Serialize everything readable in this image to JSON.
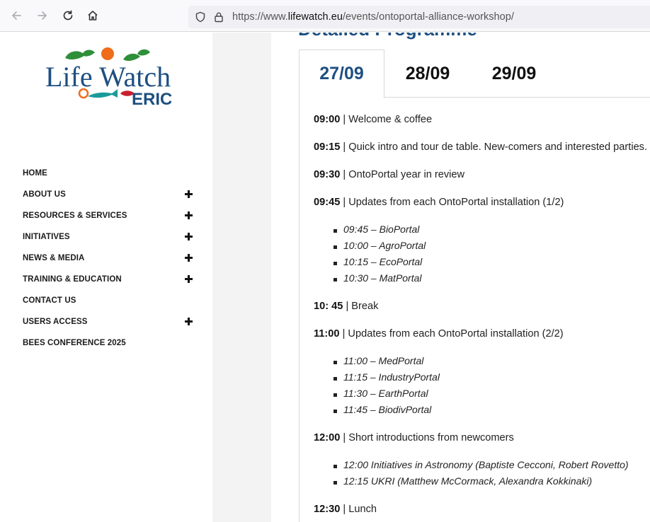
{
  "browser": {
    "url_prefix": "https://www.",
    "url_host": "lifewatch.eu",
    "url_path": "/events/ontoportal-alliance-workshop/"
  },
  "logo": {
    "word1": "Life",
    "word2": "Watch",
    "sub": "ERIC",
    "colors": {
      "blue": "#1d4f82",
      "red": "#c8202f",
      "green": "#2f8f3a",
      "orange": "#ef6c1a",
      "teal": "#1a9b9b"
    }
  },
  "sidebar": {
    "items": [
      {
        "label": "HOME",
        "expandable": false
      },
      {
        "label": "ABOUT US",
        "expandable": true
      },
      {
        "label": "RESOURCES & SERVICES",
        "expandable": true
      },
      {
        "label": "INITIATIVES",
        "expandable": true
      },
      {
        "label": "NEWS & MEDIA",
        "expandable": true
      },
      {
        "label": "TRAINING & EDUCATION",
        "expandable": true
      },
      {
        "label": "CONTACT US",
        "expandable": false
      },
      {
        "label": "USERS ACCESS",
        "expandable": true
      },
      {
        "label": "BEES CONFERENCE 2025",
        "expandable": false
      }
    ]
  },
  "main": {
    "section_title": "Detailed Programme",
    "tabs": [
      {
        "label": "27/09",
        "active": true
      },
      {
        "label": "28/09",
        "active": false
      },
      {
        "label": "29/09",
        "active": false
      }
    ],
    "programme": [
      {
        "time": "09:00",
        "text": " | Welcome & coffee"
      },
      {
        "time": "09:15",
        "text": " | Quick intro and tour de table. New-comers and interested parties."
      },
      {
        "time": "09:30",
        "text": " | OntoPortal year in review"
      },
      {
        "time": "09:45",
        "text": " | Updates from each OntoPortal installation (1/2)"
      },
      {
        "time": "10: 45",
        "text": " | Break"
      },
      {
        "time": "11:00",
        "text": " | Updates from each OntoPortal installation (2/2)"
      },
      {
        "time": "12:00",
        "text": " | Short introductions from newcomers"
      },
      {
        "time": "12:30",
        "text": " | Lunch"
      }
    ],
    "bullets_a": [
      "09:45 – BioPortal",
      "10:00 – AgroPortal",
      "10:15 – EcoPortal",
      "10:30 – MatPortal"
    ],
    "bullets_b": [
      "11:00 – MedPortal",
      "11:15 – IndustryPortal",
      "11:30 – EarthPortal",
      "11:45 – BiodivPortal"
    ],
    "bullets_c": [
      "12:00 Initiatives in Astronomy (Baptiste Cecconi, Robert Rovetto)",
      "12:15 UKRI (Matthew McCormack, Alexandra Kokkinaki)"
    ]
  }
}
